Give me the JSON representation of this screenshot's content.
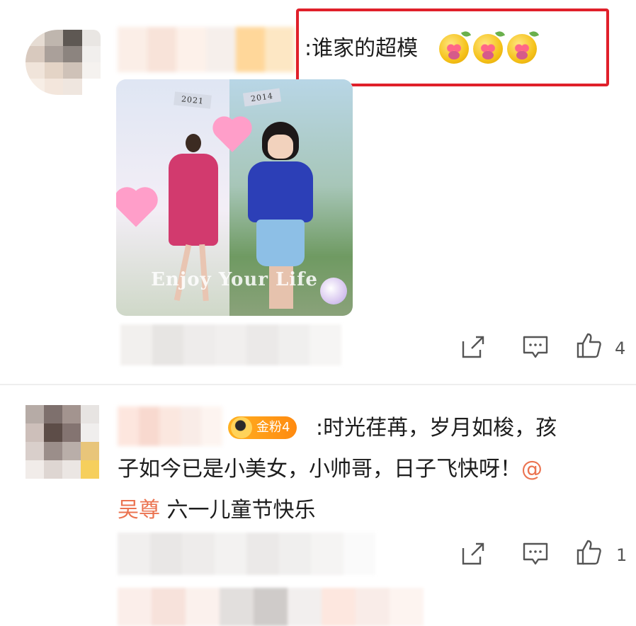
{
  "comment1": {
    "text": ":谁家的超模",
    "emojis": [
      "love-face-emoji",
      "love-face-emoji",
      "love-face-emoji"
    ],
    "photo": {
      "year_left": "2021",
      "year_right": "2014",
      "caption": "Enjoy Your Life"
    },
    "like_count": "4",
    "highlight_color": "#e0202a"
  },
  "comment2": {
    "badge": "金粉4",
    "text_line1": ":时光荏苒，岁月如梭，孩",
    "text_line2": "子如今已是小美女，小帅哥，日子飞快呀！",
    "mention_at": "@",
    "mention_name": "吴尊",
    "text_line3_rest": " 六一儿童节快乐",
    "like_count": "1",
    "mention_color": "#eb7350"
  },
  "icons": {
    "share": "share-icon",
    "comment": "comment-icon",
    "like": "thumbs-up-icon"
  }
}
